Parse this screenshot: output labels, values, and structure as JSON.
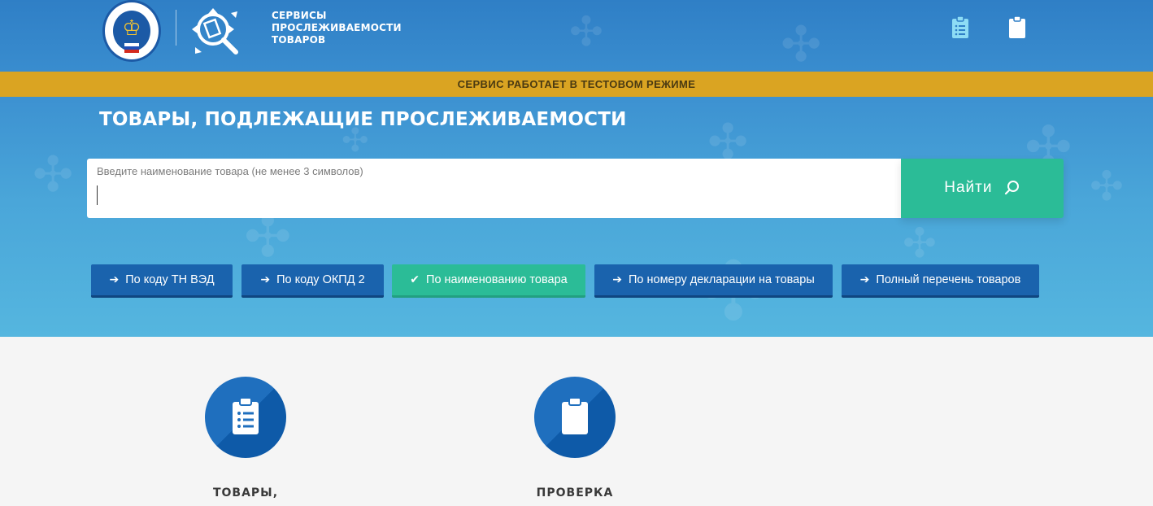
{
  "header": {
    "brand_line1": "СЕРВИСЫ",
    "brand_line2": "ПРОСЛЕЖИВАЕМОСТИ",
    "brand_line3": "ТОВАРОВ",
    "logo_fns_icon": "fns-emblem-icon",
    "logo_tracking_icon": "tracking-magnifier-icon",
    "icon_left": "clipboard-list-icon",
    "icon_right": "clipboard-icon"
  },
  "banner": {
    "text": "СЕРВИС РАБОТАЕТ В ТЕСТОВОМ РЕЖИМЕ",
    "color": "#daa422"
  },
  "main": {
    "title": "ТОВАРЫ, ПОДЛЕЖАЩИЕ ПРОСЛЕЖИВАЕМОСТИ",
    "search": {
      "label": "Введите наименование товара (не менее 3 символов)",
      "value": "",
      "button_label": "Найти",
      "button_icon": "search-icon"
    },
    "tabs": [
      {
        "label": "По коду ТН ВЭД",
        "icon": "arrow-right-icon",
        "active": false
      },
      {
        "label": "По коду ОКПД 2",
        "icon": "arrow-right-icon",
        "active": false
      },
      {
        "label": "По наименованию товара",
        "icon": "check-icon",
        "active": true
      },
      {
        "label": "По номеру декларации на товары",
        "icon": "arrow-right-icon",
        "active": false
      },
      {
        "label": "Полный перечень товаров",
        "icon": "arrow-right-icon",
        "active": false
      }
    ]
  },
  "features": [
    {
      "title": "ТОВАРЫ,",
      "icon": "clipboard-list-icon"
    },
    {
      "title": "ПРОВЕРКА",
      "icon": "clipboard-icon"
    }
  ],
  "colors": {
    "primary": "#1a63ad",
    "accent": "#2bbc97",
    "warning": "#daa422"
  }
}
